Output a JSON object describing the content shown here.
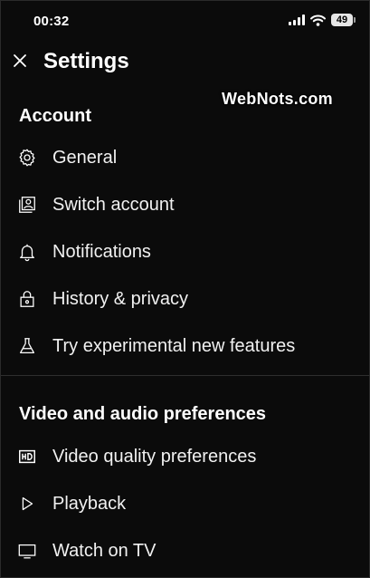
{
  "status_bar": {
    "time": "00:32",
    "battery": "49",
    "icons": [
      "signal-icon",
      "wifi-icon",
      "battery-icon"
    ]
  },
  "header": {
    "title": "Settings",
    "close_icon": "close-icon"
  },
  "watermark": "WebNots.com",
  "sections": {
    "account": {
      "title": "Account",
      "items": [
        {
          "label": "General",
          "icon": "gear-icon"
        },
        {
          "label": "Switch account",
          "icon": "switch-account-icon"
        },
        {
          "label": "Notifications",
          "icon": "bell-icon"
        },
        {
          "label": "History & privacy",
          "icon": "lock-icon"
        },
        {
          "label": "Try experimental new features",
          "icon": "flask-icon"
        }
      ]
    },
    "video_audio": {
      "title": "Video and audio preferences",
      "items": [
        {
          "label": "Video quality preferences",
          "icon": "hd-icon"
        },
        {
          "label": "Playback",
          "icon": "play-icon"
        },
        {
          "label": "Watch on TV",
          "icon": "tv-icon"
        }
      ]
    }
  },
  "colors": {
    "background": "#0b0b0b",
    "text": "#ffffff",
    "divider": "#2e2e2e"
  }
}
